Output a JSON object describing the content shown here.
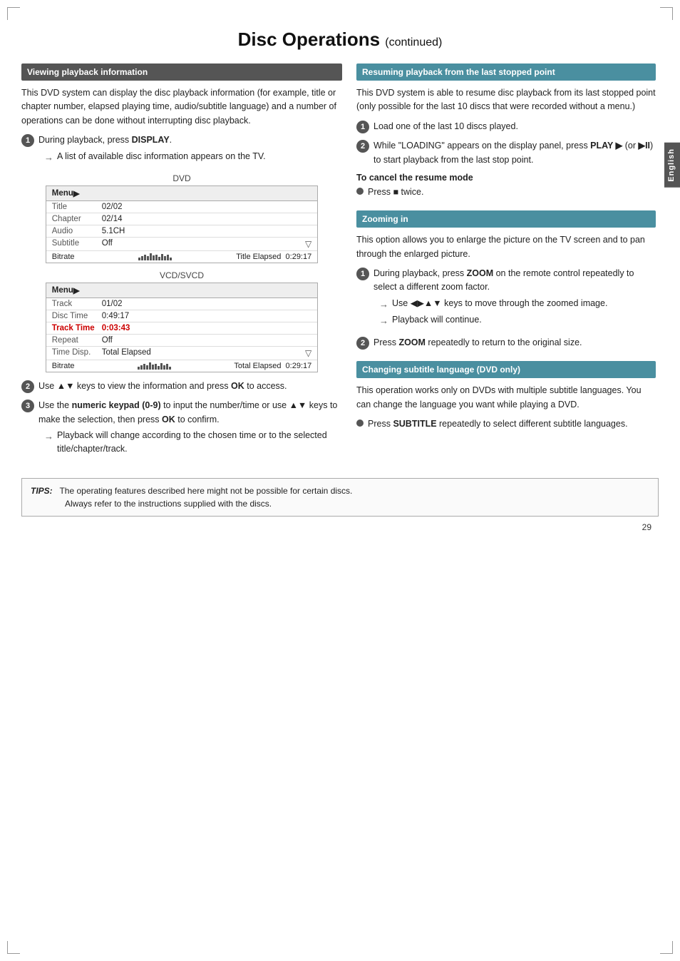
{
  "page": {
    "title": "Disc Operations",
    "continued": "(continued)",
    "page_number": "29"
  },
  "side_tab": {
    "label": "English"
  },
  "left_section": {
    "header": "Viewing playback information",
    "intro": "This DVD system can display the disc playback information (for example, title or chapter number, elapsed playing time, audio/subtitle language) and a number of operations can be done without interrupting disc playback.",
    "step1": {
      "num": "1",
      "text_before": "During playback, press ",
      "bold": "DISPLAY",
      "text_after": ".",
      "arrow": "A list of available disc information appears on the TV."
    },
    "dvd_table": {
      "label": "DVD",
      "menu_label": "Menu",
      "menu_arrow": "▶",
      "rows": [
        {
          "label": "Title",
          "value": "02/02",
          "highlight": false
        },
        {
          "label": "Chapter",
          "value": "02/14",
          "highlight": false
        },
        {
          "label": "Audio",
          "value": "5.1CH",
          "highlight": false
        },
        {
          "label": "Subtitle",
          "value": "Off",
          "highlight": false
        }
      ],
      "bitrate_label": "Bitrate",
      "elapsed_label": "Title Elapsed",
      "elapsed_value": "0:29:17"
    },
    "vcd_table": {
      "label": "VCD/SVCD",
      "menu_label": "Menu",
      "menu_arrow": "▶",
      "rows": [
        {
          "label": "Track",
          "value": "01/02",
          "highlight": false
        },
        {
          "label": "Disc Time",
          "value": "0:49:17",
          "highlight": false
        },
        {
          "label": "Track Time",
          "value": "0:03:43",
          "highlight": true
        },
        {
          "label": "Repeat",
          "value": "Off",
          "highlight": false
        },
        {
          "label": "Time Disp.",
          "value": "Total Elapsed",
          "highlight": false
        }
      ],
      "bitrate_label": "Bitrate",
      "elapsed_label": "Total Elapsed",
      "elapsed_value": "0:29:17"
    },
    "step2": {
      "num": "2",
      "text": "Use ▲▼ keys to view the information and press ",
      "bold": "OK",
      "text_after": " to access."
    },
    "step3": {
      "num": "3",
      "text_before": "Use the ",
      "bold1": "numeric keypad (0-9)",
      "text_middle": " to input the number/time or use ▲▼ keys to make the selection, then press ",
      "bold2": "OK",
      "text_after": " to confirm.",
      "arrow": "Playback will change according to the chosen time or to the selected title/chapter/track."
    }
  },
  "right_section": {
    "resume_header": "Resuming playback from the last stopped point",
    "resume_intro": "This DVD system is able to resume disc playback from its last stopped point (only possible for the last 10 discs that were recorded without a menu.)",
    "resume_step1": "Load one of the last 10 discs played.",
    "resume_step2_before": "While \"LOADING\" appears on the display panel, press ",
    "resume_step2_bold1": "PLAY",
    "resume_step2_play": "▶",
    "resume_step2_middle": " (or ",
    "resume_step2_bold2": "▶II",
    "resume_step2_after": ") to start playback from the last stop point.",
    "cancel_heading": "To cancel the resume mode",
    "cancel_text_before": "Press ",
    "cancel_bold": "■",
    "cancel_text_after": " twice.",
    "zoom_header": "Zooming in",
    "zoom_intro": "This option allows you to enlarge the picture on the TV screen and to pan through the enlarged picture.",
    "zoom_step1_before": "During playback, press ",
    "zoom_step1_bold": "ZOOM",
    "zoom_step1_after": " on the remote control repeatedly to select a different zoom factor.",
    "zoom_arrow1": "Use ◀▶▲▼ keys to move through the zoomed image.",
    "zoom_arrow2": "Playback will continue.",
    "zoom_step2_before": "Press ",
    "zoom_step2_bold": "ZOOM",
    "zoom_step2_after": " repeatedly to return to the original size.",
    "subtitle_header": "Changing subtitle language (DVD only)",
    "subtitle_intro": "This operation works only on DVDs with multiple subtitle languages. You can change the language you want while playing a DVD.",
    "subtitle_dot_before": "Press ",
    "subtitle_dot_bold": "SUBTITLE",
    "subtitle_dot_after": " repeatedly to select different subtitle languages."
  },
  "tips": {
    "label": "TIPS:",
    "line1": "The operating features described here might not be possible for certain discs.",
    "line2": "Always refer to the instructions supplied with the discs."
  },
  "icons": {
    "circle_num": "●",
    "arrow_right": "→",
    "play": "▶",
    "stop": "■",
    "pause_play": "▶II"
  }
}
